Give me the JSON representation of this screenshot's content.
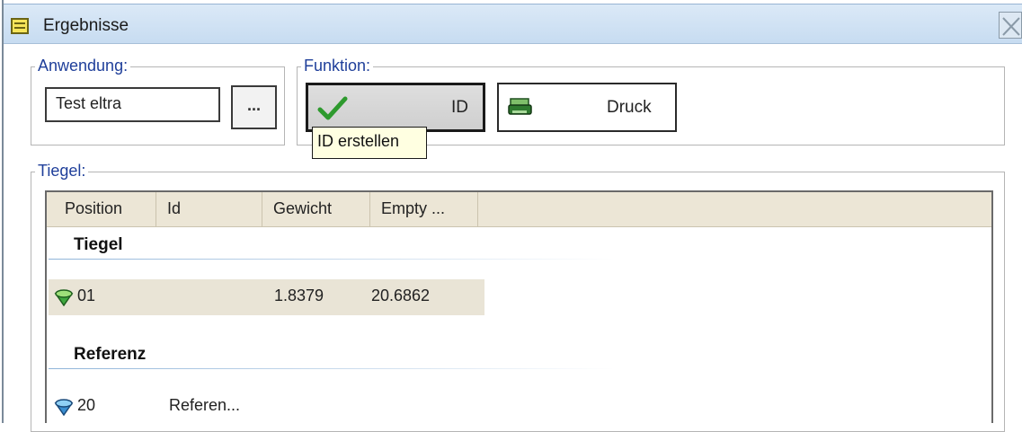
{
  "window": {
    "title": "Ergebnisse",
    "icon": "list-window-icon",
    "close_icon": "close-icon"
  },
  "anwendung": {
    "legend": "Anwendung:",
    "value": "Test eltra",
    "browse_label": "..."
  },
  "funktion": {
    "legend": "Funktion:",
    "id_button": {
      "label": "ID",
      "icon": "checkmark-icon",
      "accent": "#2e9a2e"
    },
    "druck_button": {
      "label": "Druck",
      "icon": "printer-icon",
      "accent": "#1f6b1f"
    },
    "tooltip": "ID erstellen"
  },
  "tiegel": {
    "legend": "Tiegel:",
    "columns": [
      "Position",
      "Id",
      "Gewicht",
      "Empty ..."
    ],
    "groups": [
      {
        "title": "Tiegel",
        "rows": [
          {
            "icon": "green-crucible-icon",
            "position": "01",
            "id": "",
            "gewicht": "1.8379",
            "empty": "20.6862",
            "selected": true
          }
        ]
      },
      {
        "title": "Referenz",
        "rows": [
          {
            "icon": "blue-crucible-icon",
            "position": "20",
            "id": "Referen...",
            "gewicht": "",
            "empty": "",
            "selected": false
          }
        ]
      }
    ]
  },
  "colors": {
    "titlebar": "#c7dcf1",
    "legend_text": "#1f3f9a",
    "header_bg": "#ece6d6",
    "selected_row": "#e9e4d6",
    "tooltip_bg": "#ffffe1"
  }
}
